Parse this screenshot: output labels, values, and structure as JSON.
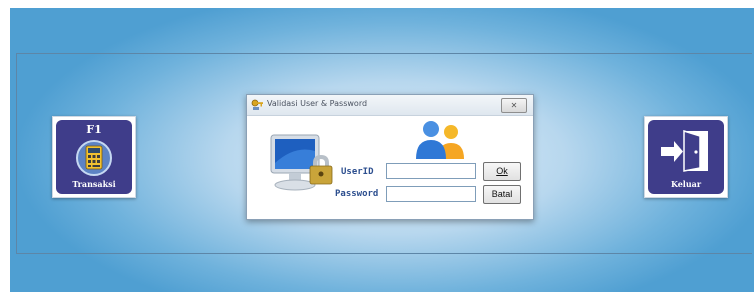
{
  "menu": {
    "transaksi": {
      "key": "F1",
      "label": "Transaksi",
      "icon": "calculator-icon"
    },
    "keluar": {
      "label": "Keluar",
      "icon": "exit-door-icon"
    }
  },
  "dialog": {
    "title": "Validasi User & Password",
    "close_label": "✕",
    "userid_label": "UserID",
    "password_label": "Password",
    "userid_value": "",
    "password_value": "",
    "ok_label": "Ok",
    "batal_label": "Batal",
    "icons": [
      "key-icon",
      "computer-lock-icon",
      "users-icon"
    ]
  },
  "colors": {
    "tile_bg": "#3f3d8a",
    "label_text": "#2d4f8f",
    "background_edge": "#4f9fd2",
    "background_center": "#e6f2fb"
  }
}
